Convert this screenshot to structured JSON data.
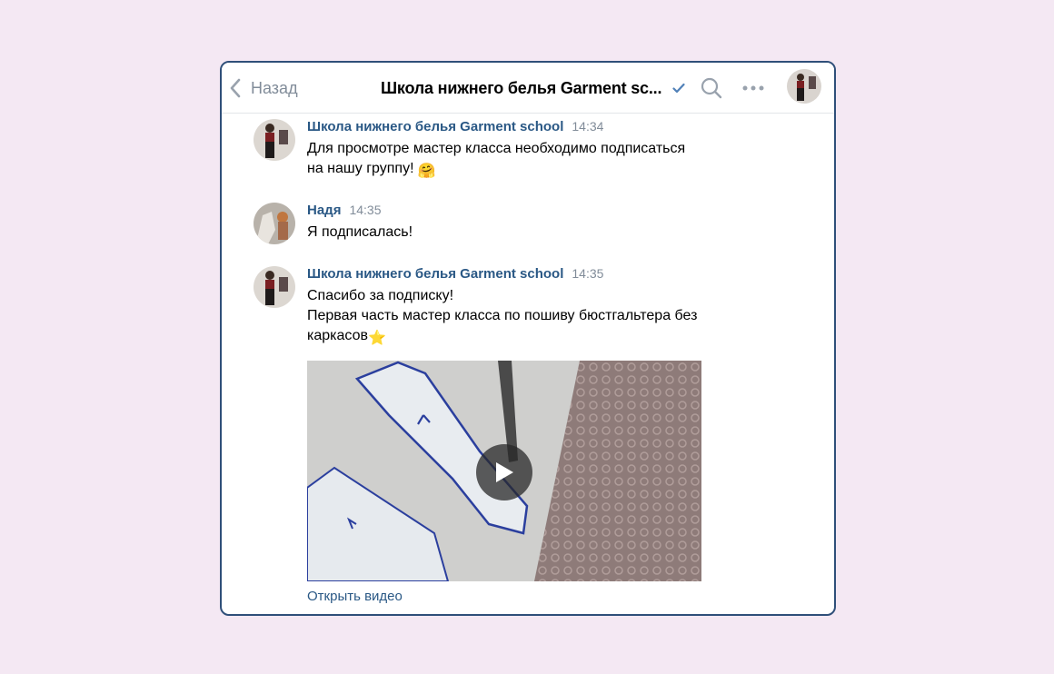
{
  "header": {
    "back_label": "Назад",
    "title": "Школа нижнего белья Garment sc...",
    "verified": true
  },
  "icons": [
    "chevron-left-icon",
    "verified-check-icon",
    "search-icon",
    "more-dots-icon",
    "play-icon"
  ],
  "colors": {
    "accent": "#2a5885",
    "border": "#2f4f79",
    "muted": "#818c99",
    "background": "#f4e8f3"
  },
  "messages": [
    {
      "author": "Школа нижнего белья Garment school",
      "time": "14:34",
      "lines": [
        "Для просмотре мастер класса необходимо подписаться",
        "на нашу группу!"
      ],
      "emoji": "🤗"
    },
    {
      "author": "Надя",
      "time": "14:35",
      "lines": [
        "Я подписалась!"
      ]
    },
    {
      "author": "Школа нижнего белья Garment school",
      "time": "14:35",
      "lines": [
        "Спасибо за подписку!",
        "Первая часть мастер класса по пошиву бюстгальтера без",
        "каркасов"
      ],
      "emoji": "⭐",
      "attachment": {
        "type": "video",
        "open_label": "Открыть видео"
      }
    }
  ]
}
